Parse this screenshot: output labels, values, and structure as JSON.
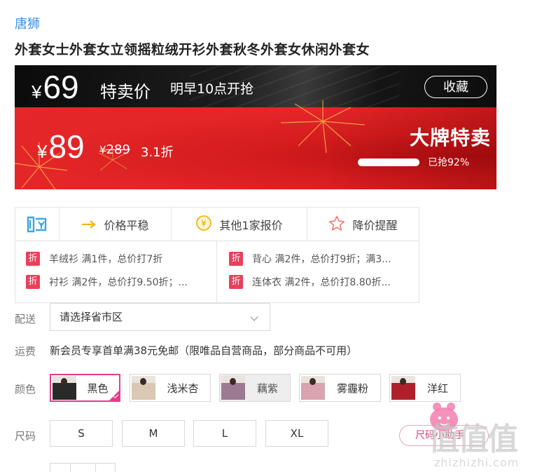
{
  "product": {
    "brand": "唐狮",
    "title": "外套女士外套女立领摇粒绒开衫外套秋冬外套女休闲外套女"
  },
  "flash_sale": {
    "currency": "¥",
    "price": "69",
    "label": "特卖价",
    "start_time": "明早10点开抢",
    "favorite_label": "收藏"
  },
  "pricing": {
    "currency": "¥",
    "current_price": "89",
    "original_currency": "¥",
    "original_price": "289",
    "discount": "3.1折",
    "badge": "大牌特卖",
    "sold_progress": 0.92,
    "sold_text": "已抢92%"
  },
  "info": {
    "gou_icon": "gou-shopping-icon",
    "items": [
      {
        "icon": "arrow-right-icon",
        "label": "价格平稳"
      },
      {
        "icon": "yen-coin-icon",
        "label": "其他1家报价"
      },
      {
        "icon": "star-outline-icon",
        "label": "降价提醒"
      }
    ],
    "promo_badge": "折",
    "promotions": [
      "羊绒衫 满1件，总价打7折",
      "背心 满2件，总价打9折；满3...",
      "衬衫 满2件，总价打9.50折；...",
      "连体衣 满2件，总价打8.80折..."
    ]
  },
  "delivery": {
    "label": "配送",
    "placeholder": "请选择省市区"
  },
  "shipping": {
    "label": "运费",
    "text": "新会员专享首单满38元免邮（限唯品自营商品，部分商品不可用）"
  },
  "colors": {
    "label": "颜色",
    "options": [
      {
        "name": "黑色",
        "selected": true,
        "available": true,
        "swatch": "#2a2a2a"
      },
      {
        "name": "浅米杏",
        "selected": false,
        "available": true,
        "swatch": "#d9c8b2"
      },
      {
        "name": "藕紫",
        "selected": false,
        "available": false,
        "swatch": "#9c7b92"
      },
      {
        "name": "雾霾粉",
        "selected": false,
        "available": true,
        "swatch": "#d9a3b0"
      },
      {
        "name": "洋红",
        "selected": false,
        "available": true,
        "swatch": "#b0202c"
      }
    ]
  },
  "sizes": {
    "label": "尺码",
    "options": [
      "S",
      "M",
      "L",
      "XL"
    ],
    "guide_label": "尺码小助手"
  },
  "watermark": {
    "logo_text": "值值值",
    "site": "zhizhizhi.com"
  }
}
